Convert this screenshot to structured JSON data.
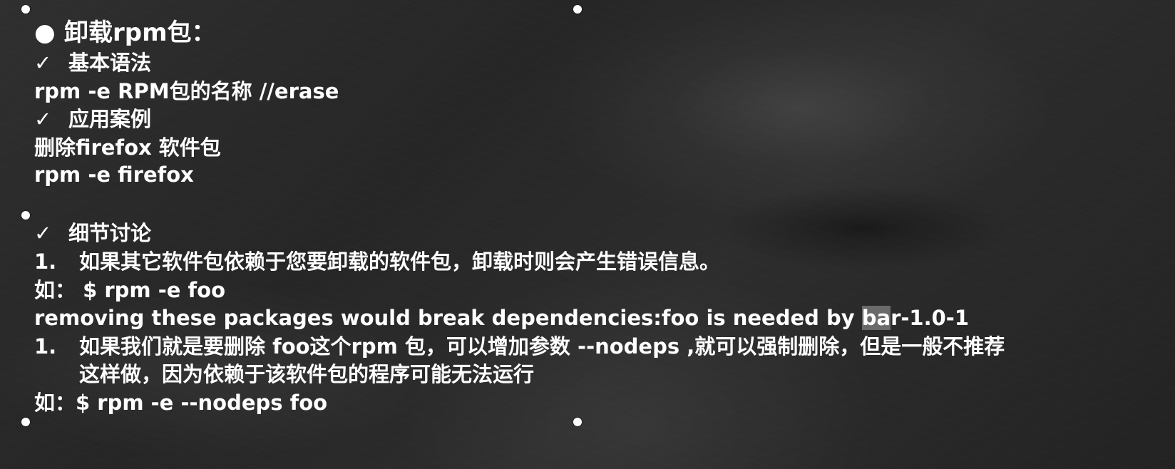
{
  "slide": {
    "title": "卸载rpm包：",
    "sections": {
      "syntax_heading": "基本语法",
      "syntax_text": "rpm -e RPM包的名称  //erase",
      "example_heading": "应用案例",
      "example_desc": "删除firefox  软件包",
      "example_command": "rpm -e  firefox",
      "details_heading": "细节讨论",
      "detail1_number": "1.",
      "detail1_text": "如果其它软件包依赖于您要卸载的软件包，卸载时则会产生错误信息。",
      "detail1_example": "如：  $ rpm -e  foo",
      "detail1_output_prefix": "removing these packages would break dependencies:foo is needed by ",
      "detail1_output_highlight": "ba",
      "detail1_output_suffix": "r-1.0-1",
      "detail2_number": "1.",
      "detail2_text_line1": "如果我们就是要删除 foo这个rpm 包，可以增加参数 --nodeps ,就可以强制删除，但是一般不推荐",
      "detail2_text_line2": "这样做，因为依赖于该软件包的程序可能无法运行",
      "detail2_example": "如：$ rpm -e --nodeps foo"
    }
  },
  "icons": {
    "bullet": "●",
    "check": "✓"
  },
  "colors": {
    "text": "#ffffff",
    "board": "#2a2a2a",
    "highlight": "#6a6a6a"
  }
}
